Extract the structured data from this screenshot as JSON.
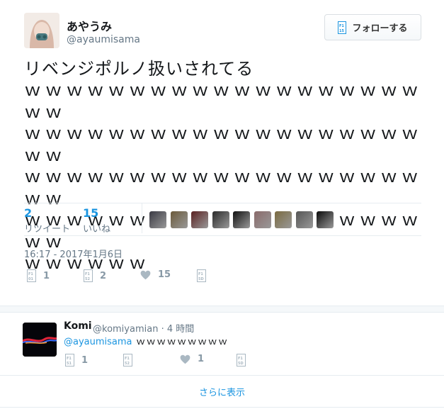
{
  "tweet": {
    "display_name": "あやうみ",
    "screen_name": "@ayaumisama",
    "follow_label": "フォローする",
    "text_line1": "リベンジポルノ扱いされてる",
    "text_w_lines": [
      "ｗｗｗｗｗｗｗｗｗｗｗｗｗｗｗｗｗｗｗｗｗ",
      "ｗｗｗｗｗｗｗｗｗｗｗｗｗｗｗｗｗｗｗｗｗ",
      "ｗｗｗｗｗｗｗｗｗｗｗｗｗｗｗｗｗｗｗｗｗ",
      "ｗｗｗｗｗｗｗｗｗｗｗｗｗｗｗｗｗｗｗｗｗ",
      "ｗｗｗｗｗｗ"
    ],
    "retweet_count": "2",
    "retweet_label": "リツイート",
    "like_count": "15",
    "like_label": "いいね",
    "likers": [
      {
        "color": "#3a3a44"
      },
      {
        "color": "#6b5a3a"
      },
      {
        "color": "#5a2020"
      },
      {
        "color": "#2a2a2a"
      },
      {
        "color": "#111111"
      },
      {
        "color": "#8a6a6a"
      },
      {
        "color": "#7a6a40"
      },
      {
        "color": "#555555"
      },
      {
        "color": "#0a0a0a"
      }
    ],
    "timestamp": "16:17 - 2017年1月6日",
    "actions": {
      "reply_count": "1",
      "retweet_count": "2",
      "like_count": "15"
    }
  },
  "reply": {
    "display_name": "Komi",
    "handle_time": "@komiyamian · 4 時間",
    "mention": "@ayaumisama",
    "text": " ｗｗｗｗｗｗｗｗｗ",
    "actions": {
      "reply_count": "1",
      "like_count": "1"
    }
  },
  "show_more_label": "さらに表示",
  "colors": {
    "accent": "#1b95e0",
    "muted": "#657786",
    "icon": "#8899a6",
    "divider": "#e6ecf0"
  },
  "icons": [
    "follow-icon",
    "reply-icon",
    "retweet-icon",
    "heart-icon",
    "dm-icon"
  ]
}
